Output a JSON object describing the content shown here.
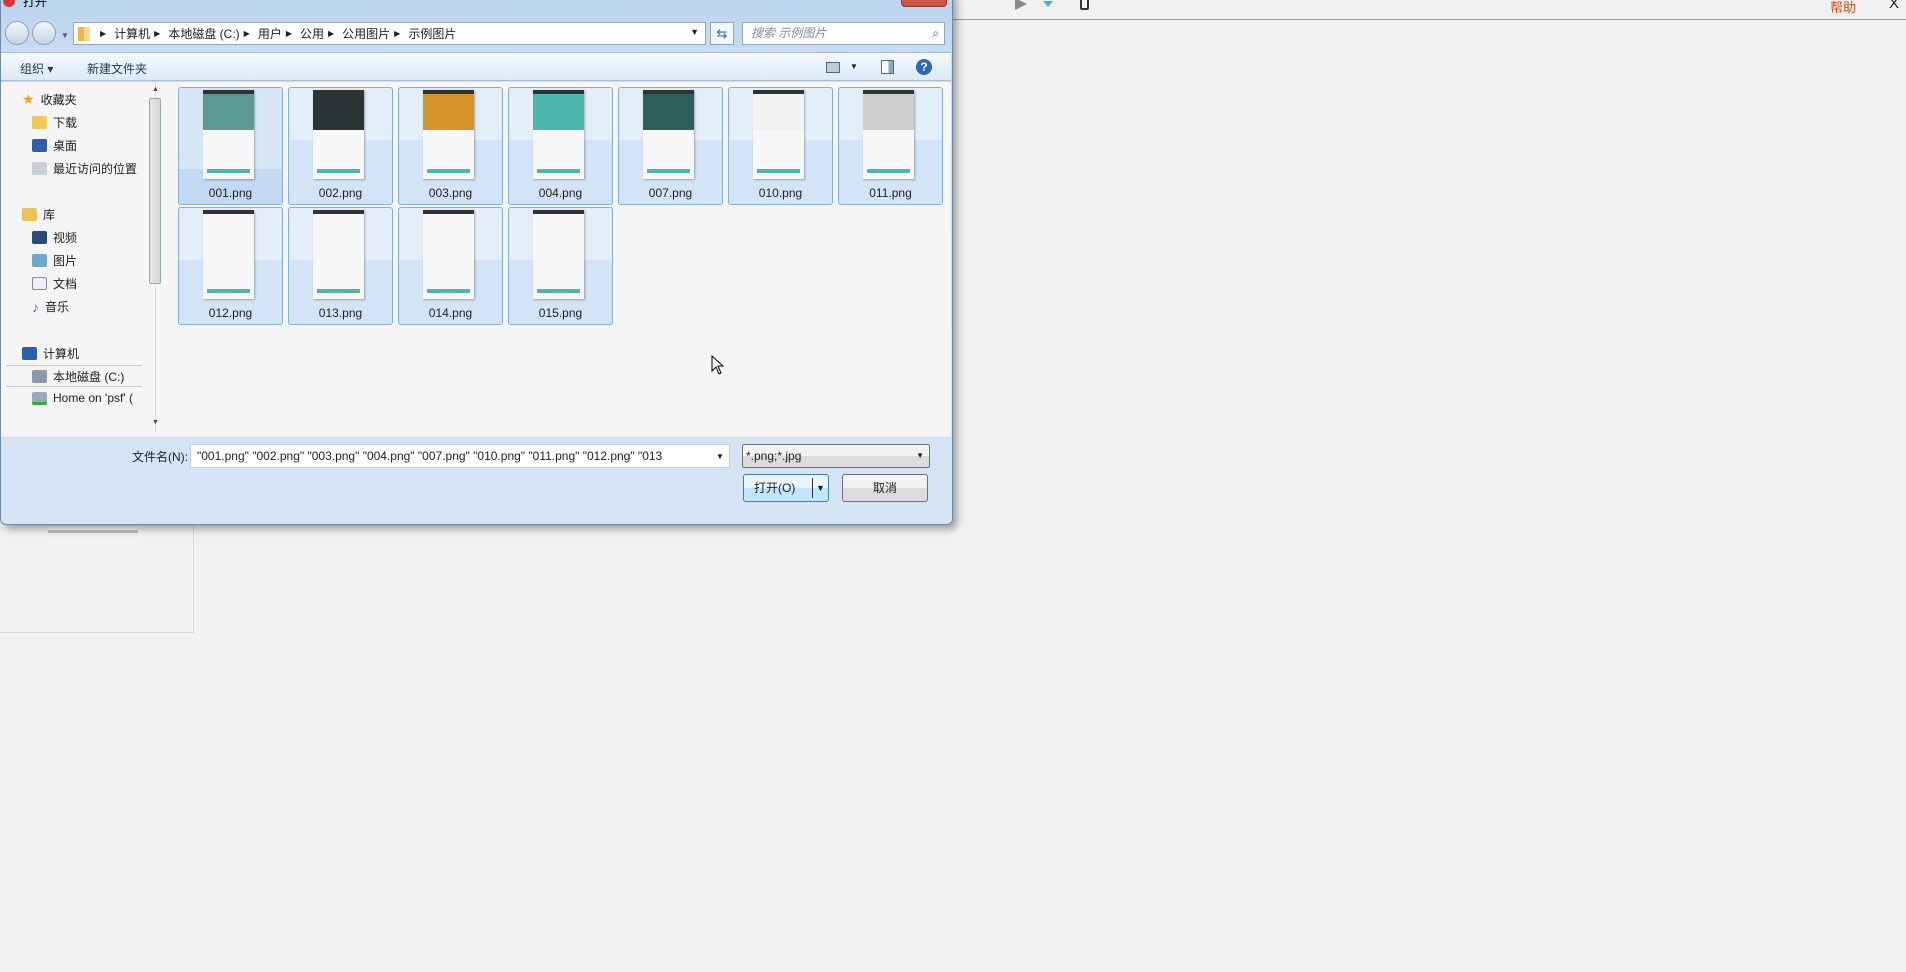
{
  "app": {
    "help_label": "帮助",
    "close_label": "X"
  },
  "dialog": {
    "title": "打开",
    "breadcrumb": [
      "计算机",
      "本地磁盘 (C:)",
      "用户",
      "公用",
      "公用图片",
      "示例图片"
    ],
    "search_placeholder": "搜索 示例图片",
    "toolbar": {
      "organize": "组织 ▾",
      "new_folder": "新建文件夹"
    },
    "nav": {
      "favorites": "收藏夹",
      "downloads": "下载",
      "desktop": "桌面",
      "recent": "最近访问的位置",
      "libraries": "库",
      "videos": "视频",
      "pictures": "图片",
      "documents": "文档",
      "music": "音乐",
      "computer": "计算机",
      "local_disk": "本地磁盘 (C:)",
      "home_psf": "Home on 'psf' ("
    },
    "files": [
      {
        "name": "001.png",
        "color": "#5a9a93"
      },
      {
        "name": "002.png",
        "color": "#2d3436"
      },
      {
        "name": "003.png",
        "color": "#d8942c"
      },
      {
        "name": "004.png",
        "color": "#4db6ac"
      },
      {
        "name": "007.png",
        "color": "#2f5f5b"
      },
      {
        "name": "010.png",
        "color": "#f2f2f2"
      },
      {
        "name": "011.png",
        "color": "#cfcfcf"
      },
      {
        "name": "012.png",
        "color": "#f7f7f7"
      },
      {
        "name": "013.png",
        "color": "#f7f7f7"
      },
      {
        "name": "014.png",
        "color": "#f7f7f7"
      },
      {
        "name": "015.png",
        "color": "#f7f7f7"
      }
    ],
    "filename_label": "文件名(N):",
    "filename_value": "\"001.png\" \"002.png\" \"003.png\" \"004.png\" \"007.png\" \"010.png\" \"011.png\" \"012.png\" \"013",
    "filter_value": "*.png;*.jpg",
    "open_label": "打开(O)",
    "cancel_label": "取消"
  }
}
